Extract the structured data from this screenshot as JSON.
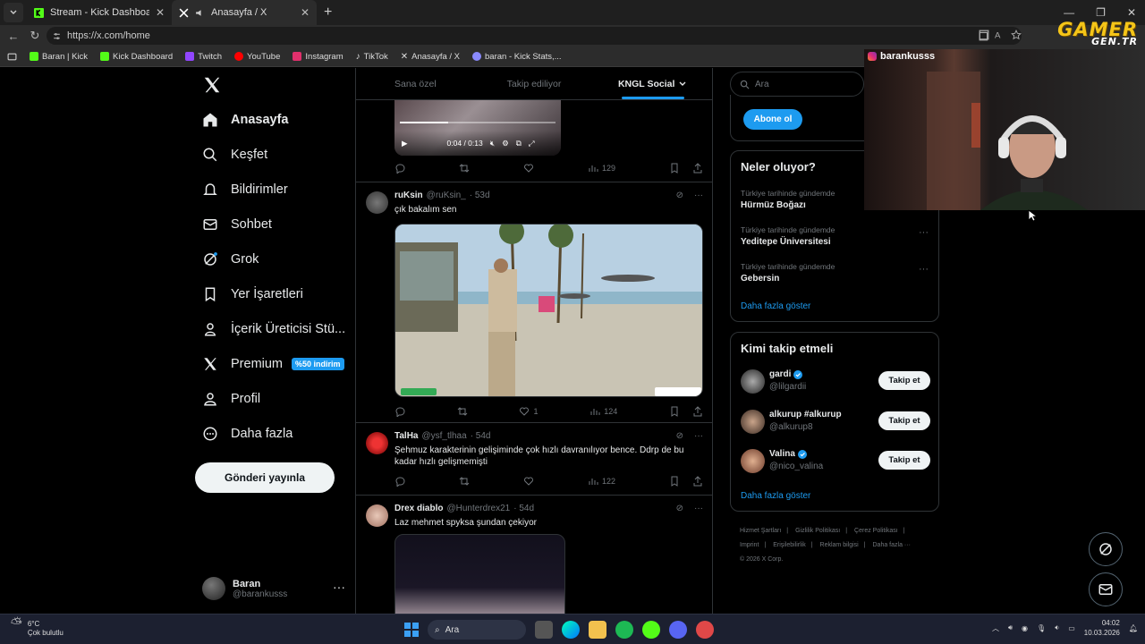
{
  "browser": {
    "tabs": [
      {
        "label": "Stream - Kick Dashboard",
        "icon": "kick-icon",
        "active": false
      },
      {
        "label": "Anasayfa / X",
        "icon": "x-icon",
        "active": true
      }
    ],
    "url": "https://x.com/home",
    "bookmarks": [
      {
        "label": "Baran | Kick",
        "color": "#53fc18"
      },
      {
        "label": "Kick Dashboard",
        "color": "#53fc18"
      },
      {
        "label": "Twitch",
        "color": "#9146ff"
      },
      {
        "label": "YouTube",
        "color": "#ff0000"
      },
      {
        "label": "Instagram",
        "color": "#e1306c"
      },
      {
        "label": "TikTok",
        "color": "#ffffff"
      },
      {
        "label": "Anasayfa / X",
        "color": "#ffffff"
      },
      {
        "label": "baran - Kick Stats,...",
        "color": "#8a8aff"
      }
    ]
  },
  "sidebar": {
    "items": [
      {
        "label": "Anasayfa",
        "icon": "home-icon"
      },
      {
        "label": "Keşfet",
        "icon": "search-icon"
      },
      {
        "label": "Bildirimler",
        "icon": "bell-icon"
      },
      {
        "label": "Sohbet",
        "icon": "mail-icon"
      },
      {
        "label": "Grok",
        "icon": "grok-icon"
      },
      {
        "label": "Yer İşaretleri",
        "icon": "bookmark-icon"
      },
      {
        "label": "İçerik Üreticisi Stü...",
        "icon": "creator-icon"
      },
      {
        "label": "Premium",
        "icon": "x-icon"
      },
      {
        "label": "Profil",
        "icon": "person-icon"
      },
      {
        "label": "Daha fazla",
        "icon": "more-circle-icon"
      }
    ],
    "premium_badge": "%50 indirim",
    "post_button": "Gönderi yayınla",
    "user": {
      "name": "Baran",
      "handle": "@barankusss"
    }
  },
  "feed": {
    "tabs": [
      "Sana özel",
      "Takip ediliyor",
      "KNGL Social"
    ],
    "video": {
      "time": "0:04 / 0:13",
      "progress": 0.31
    },
    "first_actions": {
      "views": "129"
    },
    "posts": [
      {
        "name": "ruKsin",
        "handle": "@ruKsin_",
        "time": "· 53d",
        "text": "çık bakalım sen",
        "likes": "1",
        "views": "124"
      },
      {
        "name": "TalHa",
        "handle": "@ysf_tlhaa",
        "time": "· 54d",
        "text": "Şehmuz karakterinin gelişiminde çok hızlı davranılıyor bence. Ddrp de bu kadar hızlı gelişmemişti",
        "views": "122"
      },
      {
        "name": "Drex diablo",
        "handle": "@Hunterdrex21",
        "time": "· 54d",
        "text": "Laz mehmet spyksa şundan çekiyor"
      }
    ]
  },
  "right": {
    "search_placeholder": "Ara",
    "subscribe_button": "Abone ol",
    "trends_title": "Neler oluyor?",
    "trends": [
      {
        "category": "Türkiye tarihinde gündemde",
        "title": "Hürmüz Boğazı"
      },
      {
        "category": "Türkiye tarihinde gündemde",
        "title": "Yeditepe Üniversitesi"
      },
      {
        "category": "Türkiye tarihinde gündemde",
        "title": "Gebersin"
      }
    ],
    "show_more": "Daha fazla göster",
    "who_title": "Kimi takip etmeli",
    "who": [
      {
        "name": "gardi",
        "handle": "@lilgardii",
        "verified": true
      },
      {
        "name": "alkurup #alkurup",
        "handle": "@alkurup8",
        "verified": false
      },
      {
        "name": "Valina",
        "handle": "@nico_valina",
        "verified": true
      }
    ],
    "follow_label": "Takip et",
    "footer_links": [
      "Hizmet Şartları",
      "|",
      "Gizlilik Politikası",
      "|",
      "Çerez Politikası",
      "|",
      "Imprint",
      "|",
      "Erişilebilirlik",
      "|",
      "Reklam bilgisi",
      "|",
      "Daha fazla ···"
    ],
    "copyright": "© 2026 X Corp."
  },
  "overlay": {
    "cam_username": "barankusss",
    "logo_line1": "GAMER",
    "logo_line2": "GEN.TR"
  },
  "taskbar": {
    "temp": "6°C",
    "weather": "Çok bulutlu",
    "search": "Ara",
    "time": "04:02",
    "date": "10.03.2026"
  }
}
